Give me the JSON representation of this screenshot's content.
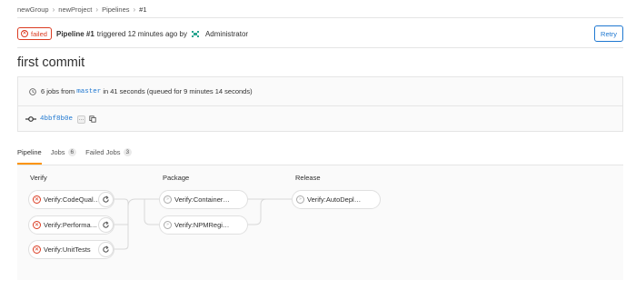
{
  "breadcrumb": [
    "newGroup",
    "newProject",
    "Pipelines",
    "#1"
  ],
  "pipeline": {
    "status": "failed",
    "title": "Pipeline #1",
    "triggered_text": "triggered 12 minutes ago by",
    "user": "Administrator",
    "retry_label": "Retry"
  },
  "commit_title": "first commit",
  "info": {
    "jobs_text": "6 jobs from",
    "branch": "master",
    "duration_text": "in 41 seconds (queued for 9 minutes 14 seconds)",
    "sha": "4bbf8b0e",
    "ellipsis": "…"
  },
  "tabs": [
    {
      "label": "Pipeline",
      "count": null,
      "active": true
    },
    {
      "label": "Jobs",
      "count": "6",
      "active": false
    },
    {
      "label": "Failed Jobs",
      "count": "3",
      "active": false
    }
  ],
  "stages": [
    {
      "name": "Verify",
      "jobs": [
        {
          "name": "Verify:CodeQual…",
          "status": "failed"
        },
        {
          "name": "Verify:Performa…",
          "status": "failed"
        },
        {
          "name": "Verify:UnitTests",
          "status": "failed"
        }
      ]
    },
    {
      "name": "Package",
      "jobs": [
        {
          "name": "Verify:Container…",
          "status": "skipped"
        },
        {
          "name": "Verify:NPMRegi…",
          "status": "skipped"
        }
      ]
    },
    {
      "name": "Release",
      "jobs": [
        {
          "name": "Verify:AutoDepl…",
          "status": "skipped"
        }
      ]
    }
  ],
  "colors": {
    "failed": "#db3b21",
    "accent": "#1f78d1",
    "tab_active": "#fc9403"
  },
  "icons": [
    "close-icon",
    "avatar-icon",
    "clock-icon",
    "commit-icon",
    "copy-icon",
    "retry-icon",
    "skipped-icon"
  ]
}
